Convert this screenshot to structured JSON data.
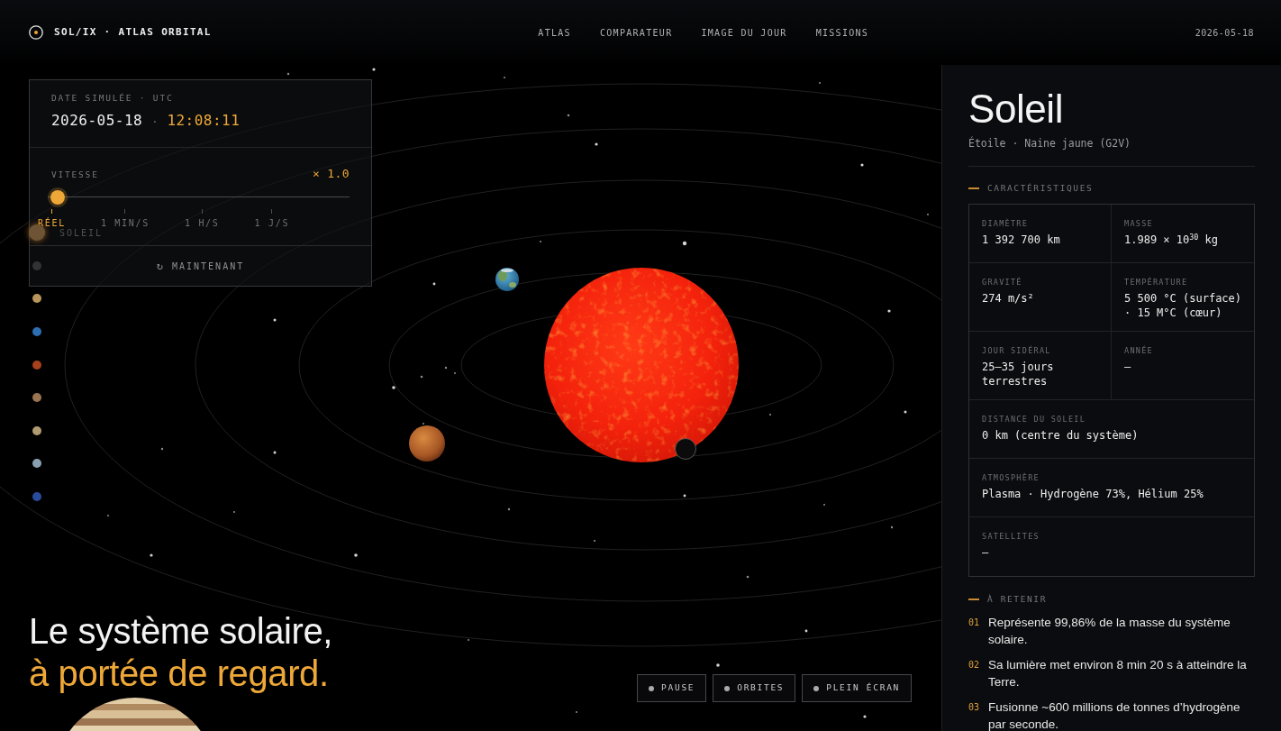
{
  "header": {
    "logo_text": "SOL/IX · ATLAS ORBITAL",
    "nav": [
      "ATLAS",
      "COMPARATEUR",
      "IMAGE DU JOUR",
      "MISSIONS"
    ],
    "date": "2026-05-18"
  },
  "control_panel": {
    "date_label": "DATE SIMULÉE · UTC",
    "date": "2026-05-18",
    "separator": "·",
    "time": "12:08:11",
    "speed_label": "VITESSE",
    "speed_reading": "× 1.0",
    "speed": {
      "level": 0
    },
    "stops": [
      {
        "label": "RÉEL",
        "selected": true
      },
      {
        "label": "1 MIN/S",
        "selected": false
      },
      {
        "label": "1 H/S",
        "selected": false
      },
      {
        "label": "1 J/S",
        "selected": false
      }
    ],
    "now_button": {
      "icon": "↻",
      "label": "MAINTENANT"
    }
  },
  "planet_list": [
    {
      "label": "SOLEIL",
      "color": "#6e5434",
      "selected": true
    },
    {
      "color": "#333336",
      "selected": false
    },
    {
      "color": "#b8955a",
      "selected": false
    },
    {
      "color": "#2d6db0",
      "selected": false
    },
    {
      "color": "#a8401c",
      "selected": false
    },
    {
      "color": "#9a7350",
      "selected": false
    },
    {
      "color": "#b09a70",
      "selected": false
    },
    {
      "color": "#8aa0b0",
      "selected": false
    },
    {
      "color": "#2a4a9a",
      "selected": false
    }
  ],
  "hero": {
    "lines": [
      {
        "kind": "plain",
        "text": "Le système solaire,"
      },
      {
        "kind": "accent",
        "text": "à portée de regard."
      }
    ]
  },
  "controls": [
    {
      "label": "PAUSE"
    },
    {
      "label": "ORBITES"
    },
    {
      "label": "PLEIN ÉCRAN"
    }
  ],
  "info_panel": {
    "title": "Soleil",
    "subtitle": "Étoile · Naine jaune (G2V)",
    "characteristics": {
      "heading": "CARACTÉRISTIQUES",
      "rows": [
        [
          {
            "label": "DIAMÈTRE",
            "value": "1 392 700 km"
          },
          {
            "label": "MASSE",
            "value": "1.989 × 10$^{30}$ kg"
          }
        ],
        [
          {
            "label": "GRAVITÉ",
            "value": "274 m/s²"
          },
          {
            "label": "TEMPÉRATURE",
            "value": "5 500 °C (surface) · 15 M°C (cœur)"
          }
        ],
        [
          {
            "label": "JOUR SIDÉRAL",
            "value": "25–35 jours terrestres"
          },
          {
            "label": "ANNÉE",
            "value": "—"
          }
        ],
        [
          {
            "label": "DISTANCE DU SOLEIL",
            "value": "0 km (centre du système)"
          }
        ],
        [
          {
            "label": "ATMOSPHÈRE",
            "value": "Plasma · Hydrogène 73%, Hélium 25%"
          }
        ],
        [
          {
            "label": "SATELLITES",
            "value": "—"
          }
        ]
      ]
    },
    "facts": {
      "heading": "À RETENIR",
      "items": [
        {
          "number": "01",
          "text": "Représente 99,86% de la masse du système solaire."
        },
        {
          "number": "02",
          "text": "Sa lumière met environ 8 min 20 s à atteindre la Terre."
        },
        {
          "number": "03",
          "text": "Fusionne ~600 millions de tonnes d’hydrogène par seconde."
        }
      ]
    }
  }
}
